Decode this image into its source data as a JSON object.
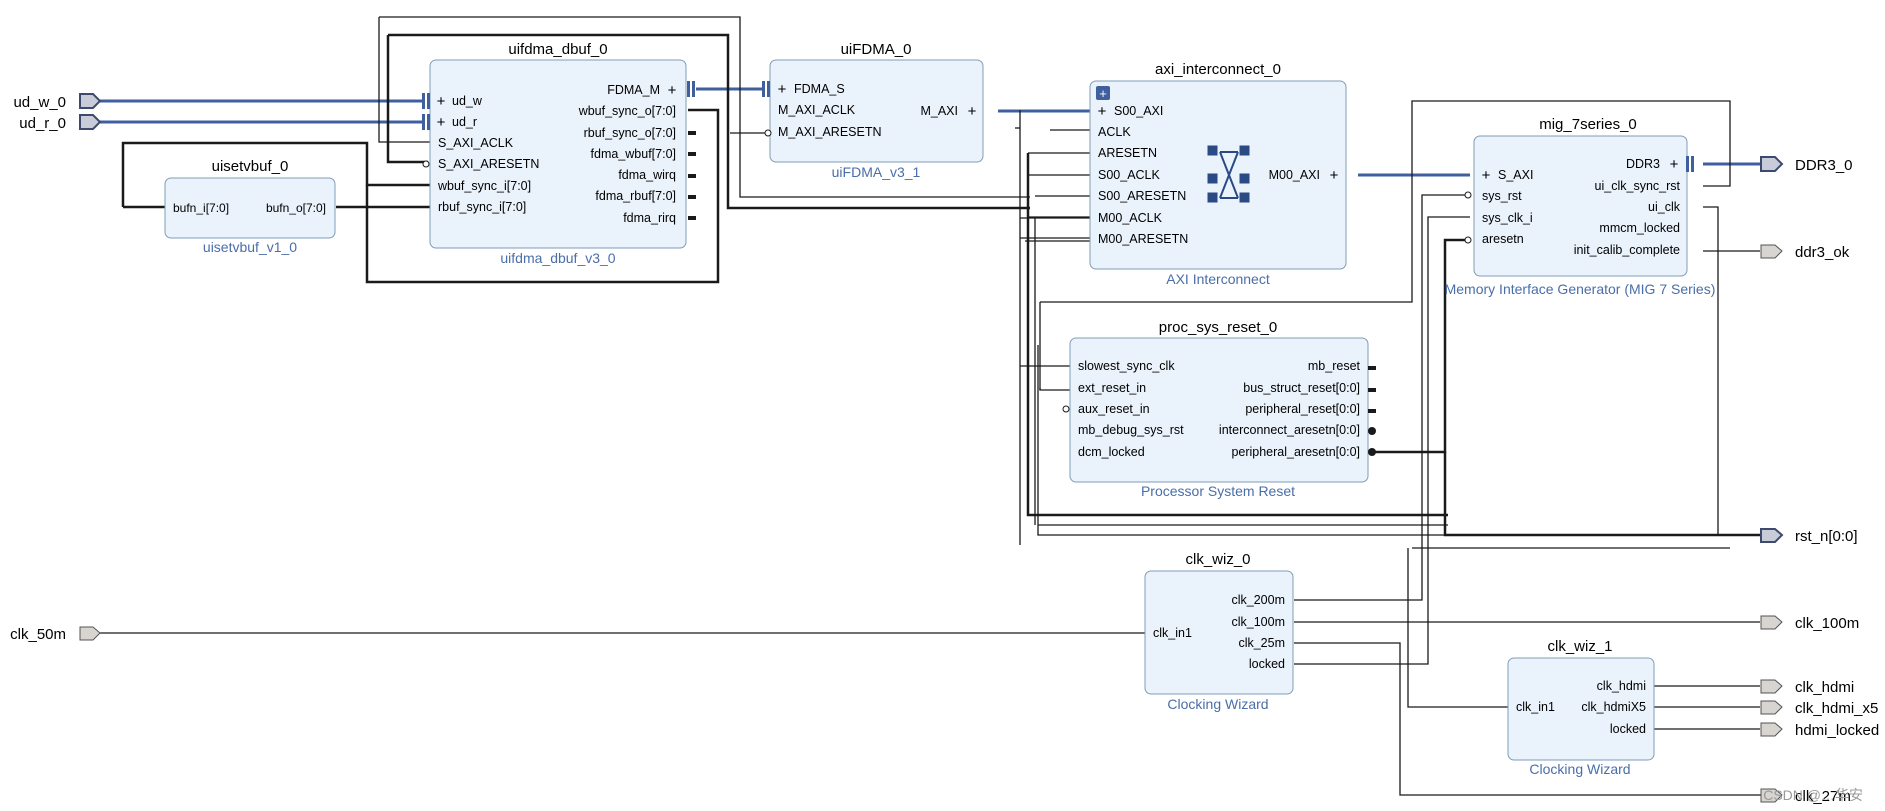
{
  "external_ports": {
    "ud_w_0": "ud_w_0",
    "ud_r_0": "ud_r_0",
    "clk_50m": "clk_50m",
    "DDR3_0": "DDR3_0",
    "ddr3_ok": "ddr3_ok",
    "rst_n": "rst_n[0:0]",
    "clk_100m": "clk_100m",
    "clk_hdmi": "clk_hdmi",
    "clk_hdmi_x5": "clk_hdmi_x5",
    "hdmi_locked": "hdmi_locked",
    "clk_27m": "clk_27m"
  },
  "blocks": {
    "uisetvbuf": {
      "name": "uisetvbuf_0",
      "type": "uisetvbuf_v1_0",
      "in": [
        "bufn_i[7:0]"
      ],
      "out": [
        "bufn_o[7:0]"
      ]
    },
    "uifdma_dbuf": {
      "name": "uifdma_dbuf_0",
      "type": "uifdma_dbuf_v3_0",
      "in": [
        "ud_w",
        "ud_r",
        "S_AXI_ACLK",
        "S_AXI_ARESETN",
        "wbuf_sync_i[7:0]",
        "rbuf_sync_i[7:0]"
      ],
      "out": [
        "FDMA_M",
        "wbuf_sync_o[7:0]",
        "rbuf_sync_o[7:0]",
        "fdma_wbuf[7:0]",
        "fdma_wirq",
        "fdma_rbuf[7:0]",
        "fdma_rirq"
      ]
    },
    "uiFDMA": {
      "name": "uiFDMA_0",
      "type": "uiFDMA_v3_1",
      "in": [
        "FDMA_S",
        "M_AXI_ACLK",
        "M_AXI_ARESETN"
      ],
      "out": [
        "M_AXI"
      ]
    },
    "axi_ic": {
      "name": "axi_interconnect_0",
      "type": "AXI Interconnect",
      "in": [
        "S00_AXI",
        "ACLK",
        "ARESETN",
        "S00_ACLK",
        "S00_ARESETN",
        "M00_ACLK",
        "M00_ARESETN"
      ],
      "out": [
        "M00_AXI"
      ]
    },
    "mig": {
      "name": "mig_7series_0",
      "type": "Memory Interface Generator (MIG 7 Series)",
      "in": [
        "S_AXI",
        "sys_rst",
        "sys_clk_i",
        "aresetn"
      ],
      "out": [
        "DDR3",
        "ui_clk_sync_rst",
        "ui_clk",
        "mmcm_locked",
        "init_calib_complete"
      ]
    },
    "psr": {
      "name": "proc_sys_reset_0",
      "type": "Processor System Reset",
      "in": [
        "slowest_sync_clk",
        "ext_reset_in",
        "aux_reset_in",
        "mb_debug_sys_rst",
        "dcm_locked"
      ],
      "out": [
        "mb_reset",
        "bus_struct_reset[0:0]",
        "peripheral_reset[0:0]",
        "interconnect_aresetn[0:0]",
        "peripheral_aresetn[0:0]"
      ]
    },
    "clk_wiz0": {
      "name": "clk_wiz_0",
      "type": "Clocking Wizard",
      "in": [
        "clk_in1"
      ],
      "out": [
        "clk_200m",
        "clk_100m",
        "clk_25m",
        "locked"
      ]
    },
    "clk_wiz1": {
      "name": "clk_wiz_1",
      "type": "Clocking Wizard",
      "in": [
        "clk_in1"
      ],
      "out": [
        "clk_hdmi",
        "clk_hdmiX5",
        "locked"
      ]
    }
  },
  "watermark": "CSDN @…华安",
  "colors": {
    "bus": "#3f5f9f",
    "wire": "#1a1a1a",
    "block_fill": "#eaf2fb",
    "block_stroke": "#7f9db9",
    "subtitle": "#4a6ea9",
    "port_fill": "#c8ccd8",
    "port_stroke": "#3d4a6e"
  }
}
